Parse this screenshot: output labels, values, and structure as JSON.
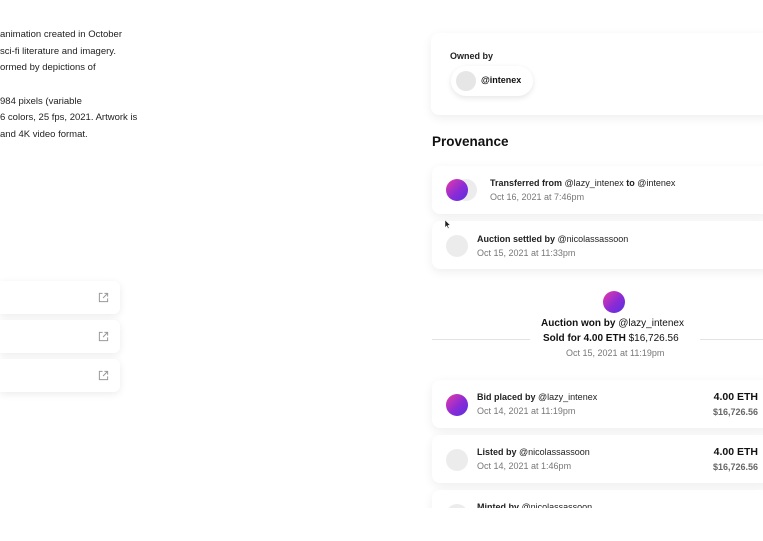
{
  "description": {
    "lines": [
      "animation created in October",
      "sci-fi literature and imagery.",
      "ormed by depictions of",
      "",
      "984 pixels (variable",
      "6 colors, 25 fps, 2021. Artwork is",
      "and 4K video format."
    ]
  },
  "links": [
    {
      "icon": "external-link-icon"
    },
    {
      "icon": "external-link-icon"
    },
    {
      "icon": "external-link-icon"
    }
  ],
  "owner": {
    "label": "Owned by",
    "username": "@intenex"
  },
  "provenance": {
    "title": "Provenance",
    "transfer": {
      "prefix": "Transferred from",
      "from": "@lazy_intenex",
      "joiner": "to",
      "to": "@intenex",
      "date": "Oct 16, 2021 at 7:46pm"
    },
    "settled": {
      "prefix": "Auction settled by",
      "user": "@nicolassassoon",
      "date": "Oct 15, 2021 at 11:33pm"
    },
    "won": {
      "prefix": "Auction won by",
      "user": "@lazy_intenex",
      "sold_prefix": "Sold for",
      "eth": "4.00 ETH",
      "usd": "$16,726.56",
      "date": "Oct 15, 2021 at 11:19pm"
    },
    "bid": {
      "prefix": "Bid placed by",
      "user": "@lazy_intenex",
      "date": "Oct 14, 2021 at 11:19pm",
      "eth": "4.00 ETH",
      "usd": "$16,726.56"
    },
    "listed": {
      "prefix": "Listed by",
      "user": "@nicolassassoon",
      "date": "Oct 14, 2021 at 1:46pm",
      "eth": "4.00 ETH",
      "usd": "$16,726.56"
    },
    "minted": {
      "prefix": "Minted by",
      "user": "@nicolassassoon"
    }
  },
  "colors": {
    "avatar_gradient_start": "#e83aa5",
    "avatar_gradient_end": "#5a2fe0",
    "card_bg": "#ffffff",
    "muted_text": "#777777"
  }
}
